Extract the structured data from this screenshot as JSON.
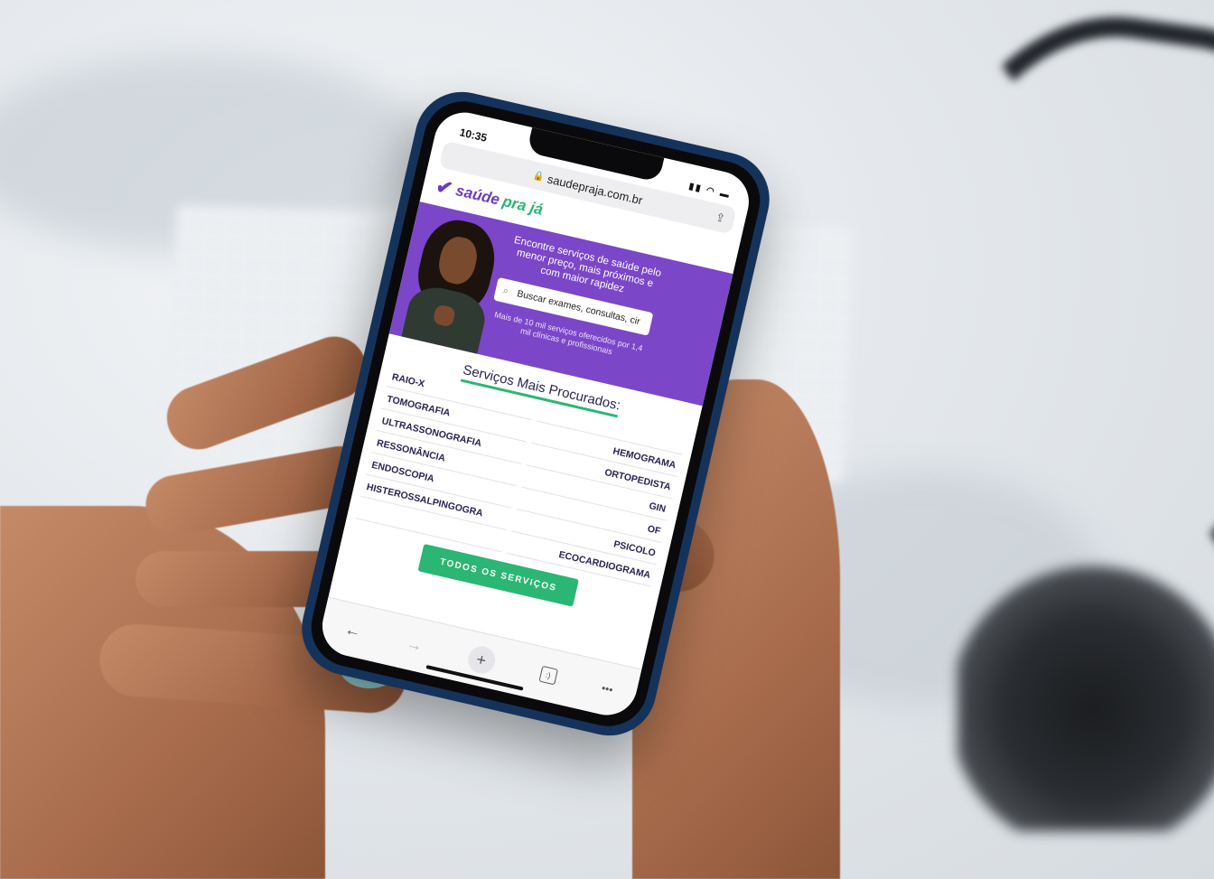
{
  "status_bar": {
    "time": "10:35",
    "icons": "signal wifi battery"
  },
  "browser": {
    "url": "saudepraja.com.br",
    "lock_icon": "lock-icon",
    "share_icon": "share-icon"
  },
  "logo": {
    "part1": "saúde",
    "part2": "pra já",
    "colors": {
      "primary": "#6b3bc4",
      "accent": "#2bb673"
    }
  },
  "hero": {
    "headline": "Encontre serviços de saúde pelo menor preço, mais próximos e com maior rapidez",
    "search_placeholder": "Buscar exames, consultas, cir",
    "subtext": "Mais de 10 mil serviços oferecidos por 1,4 mil clínicas e profissionais",
    "background": "#7b46c8"
  },
  "section": {
    "title": "Serviços Mais Procurados:"
  },
  "services": {
    "left": [
      "RAIO-X",
      "TOMOGRAFIA",
      "ULTRASSONOGRAFIA",
      "RESSONÂNCIA",
      "ENDOSCOPIA",
      "HISTEROSSALPINGOGRA"
    ],
    "right": [
      "",
      "HEMOGRAMA",
      "ORTOPEDISTA",
      "GIN",
      "OF",
      "PSICOLO",
      "ECOCARDIOGRAMA"
    ]
  },
  "cta": {
    "label": "TODOS OS SERVIÇOS"
  },
  "toolbar": {
    "back": "←",
    "forward": "→",
    "new_tab": "+",
    "tabs": ":)",
    "more": "•••"
  }
}
